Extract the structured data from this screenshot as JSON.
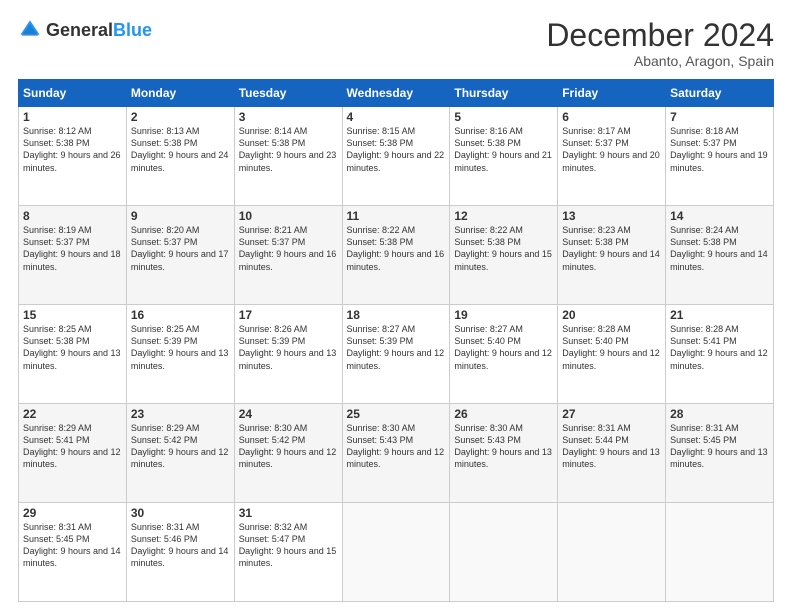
{
  "header": {
    "logo_general": "General",
    "logo_blue": "Blue",
    "month_year": "December 2024",
    "location": "Abanto, Aragon, Spain"
  },
  "days_of_week": [
    "Sunday",
    "Monday",
    "Tuesday",
    "Wednesday",
    "Thursday",
    "Friday",
    "Saturday"
  ],
  "weeks": [
    [
      {
        "day": "1",
        "sunrise": "8:12 AM",
        "sunset": "5:38 PM",
        "daylight": "9 hours and 26 minutes."
      },
      {
        "day": "2",
        "sunrise": "8:13 AM",
        "sunset": "5:38 PM",
        "daylight": "9 hours and 24 minutes."
      },
      {
        "day": "3",
        "sunrise": "8:14 AM",
        "sunset": "5:38 PM",
        "daylight": "9 hours and 23 minutes."
      },
      {
        "day": "4",
        "sunrise": "8:15 AM",
        "sunset": "5:38 PM",
        "daylight": "9 hours and 22 minutes."
      },
      {
        "day": "5",
        "sunrise": "8:16 AM",
        "sunset": "5:38 PM",
        "daylight": "9 hours and 21 minutes."
      },
      {
        "day": "6",
        "sunrise": "8:17 AM",
        "sunset": "5:37 PM",
        "daylight": "9 hours and 20 minutes."
      },
      {
        "day": "7",
        "sunrise": "8:18 AM",
        "sunset": "5:37 PM",
        "daylight": "9 hours and 19 minutes."
      }
    ],
    [
      {
        "day": "8",
        "sunrise": "8:19 AM",
        "sunset": "5:37 PM",
        "daylight": "9 hours and 18 minutes."
      },
      {
        "day": "9",
        "sunrise": "8:20 AM",
        "sunset": "5:37 PM",
        "daylight": "9 hours and 17 minutes."
      },
      {
        "day": "10",
        "sunrise": "8:21 AM",
        "sunset": "5:37 PM",
        "daylight": "9 hours and 16 minutes."
      },
      {
        "day": "11",
        "sunrise": "8:22 AM",
        "sunset": "5:38 PM",
        "daylight": "9 hours and 16 minutes."
      },
      {
        "day": "12",
        "sunrise": "8:22 AM",
        "sunset": "5:38 PM",
        "daylight": "9 hours and 15 minutes."
      },
      {
        "day": "13",
        "sunrise": "8:23 AM",
        "sunset": "5:38 PM",
        "daylight": "9 hours and 14 minutes."
      },
      {
        "day": "14",
        "sunrise": "8:24 AM",
        "sunset": "5:38 PM",
        "daylight": "9 hours and 14 minutes."
      }
    ],
    [
      {
        "day": "15",
        "sunrise": "8:25 AM",
        "sunset": "5:38 PM",
        "daylight": "9 hours and 13 minutes."
      },
      {
        "day": "16",
        "sunrise": "8:25 AM",
        "sunset": "5:39 PM",
        "daylight": "9 hours and 13 minutes."
      },
      {
        "day": "17",
        "sunrise": "8:26 AM",
        "sunset": "5:39 PM",
        "daylight": "9 hours and 13 minutes."
      },
      {
        "day": "18",
        "sunrise": "8:27 AM",
        "sunset": "5:39 PM",
        "daylight": "9 hours and 12 minutes."
      },
      {
        "day": "19",
        "sunrise": "8:27 AM",
        "sunset": "5:40 PM",
        "daylight": "9 hours and 12 minutes."
      },
      {
        "day": "20",
        "sunrise": "8:28 AM",
        "sunset": "5:40 PM",
        "daylight": "9 hours and 12 minutes."
      },
      {
        "day": "21",
        "sunrise": "8:28 AM",
        "sunset": "5:41 PM",
        "daylight": "9 hours and 12 minutes."
      }
    ],
    [
      {
        "day": "22",
        "sunrise": "8:29 AM",
        "sunset": "5:41 PM",
        "daylight": "9 hours and 12 minutes."
      },
      {
        "day": "23",
        "sunrise": "8:29 AM",
        "sunset": "5:42 PM",
        "daylight": "9 hours and 12 minutes."
      },
      {
        "day": "24",
        "sunrise": "8:30 AM",
        "sunset": "5:42 PM",
        "daylight": "9 hours and 12 minutes."
      },
      {
        "day": "25",
        "sunrise": "8:30 AM",
        "sunset": "5:43 PM",
        "daylight": "9 hours and 12 minutes."
      },
      {
        "day": "26",
        "sunrise": "8:30 AM",
        "sunset": "5:43 PM",
        "daylight": "9 hours and 13 minutes."
      },
      {
        "day": "27",
        "sunrise": "8:31 AM",
        "sunset": "5:44 PM",
        "daylight": "9 hours and 13 minutes."
      },
      {
        "day": "28",
        "sunrise": "8:31 AM",
        "sunset": "5:45 PM",
        "daylight": "9 hours and 13 minutes."
      }
    ],
    [
      {
        "day": "29",
        "sunrise": "8:31 AM",
        "sunset": "5:45 PM",
        "daylight": "9 hours and 14 minutes."
      },
      {
        "day": "30",
        "sunrise": "8:31 AM",
        "sunset": "5:46 PM",
        "daylight": "9 hours and 14 minutes."
      },
      {
        "day": "31",
        "sunrise": "8:32 AM",
        "sunset": "5:47 PM",
        "daylight": "9 hours and 15 minutes."
      },
      null,
      null,
      null,
      null
    ]
  ]
}
